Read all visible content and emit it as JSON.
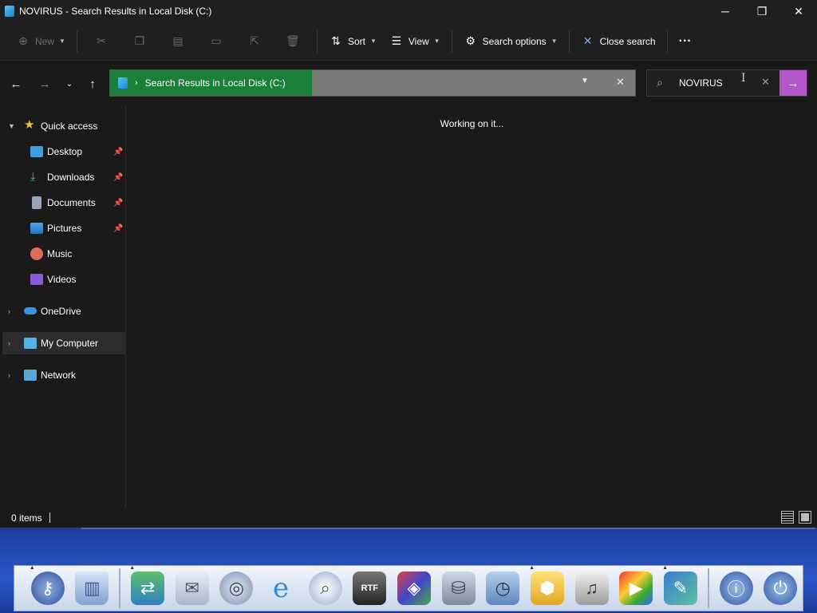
{
  "window": {
    "title": "NOVIRUS - Search Results in Local Disk (C:)",
    "controls": {
      "minimize": "─",
      "maximize": "❐",
      "close": "✕"
    }
  },
  "commandbar": {
    "new_label": "New",
    "sort_label": "Sort",
    "view_label": "View",
    "search_options_label": "Search options",
    "close_search_label": "Close search",
    "more_label": "···"
  },
  "address": {
    "crumb": "Search Results in Local Disk (C:)",
    "search_value": "NOVIRUS"
  },
  "sidebar": {
    "items": [
      {
        "label": "Quick access"
      },
      {
        "label": "Desktop"
      },
      {
        "label": "Downloads"
      },
      {
        "label": "Documents"
      },
      {
        "label": "Pictures"
      },
      {
        "label": "Music"
      },
      {
        "label": "Videos"
      },
      {
        "label": "OneDrive"
      },
      {
        "label": "My Computer"
      },
      {
        "label": "Network"
      }
    ]
  },
  "content": {
    "status_message": "Working on it..."
  },
  "statusbar": {
    "item_count": "0 items"
  },
  "dock": {
    "items": [
      "keychain-icon",
      "trash-icon",
      "migration-icon",
      "mail-icon",
      "web-icon",
      "explorer-icon",
      "preview-icon",
      "rtf-document-icon",
      "cube-icon",
      "disk-utility-icon",
      "time-folder-icon",
      "hexagon-app-icon",
      "music-notes-icon",
      "media-player-icon",
      "paint-icon",
      "info-icon",
      "power-icon"
    ]
  },
  "colors": {
    "crumb_bg": "#1a7f37",
    "search_go": "#b455c9",
    "window_bg": "#191919"
  }
}
